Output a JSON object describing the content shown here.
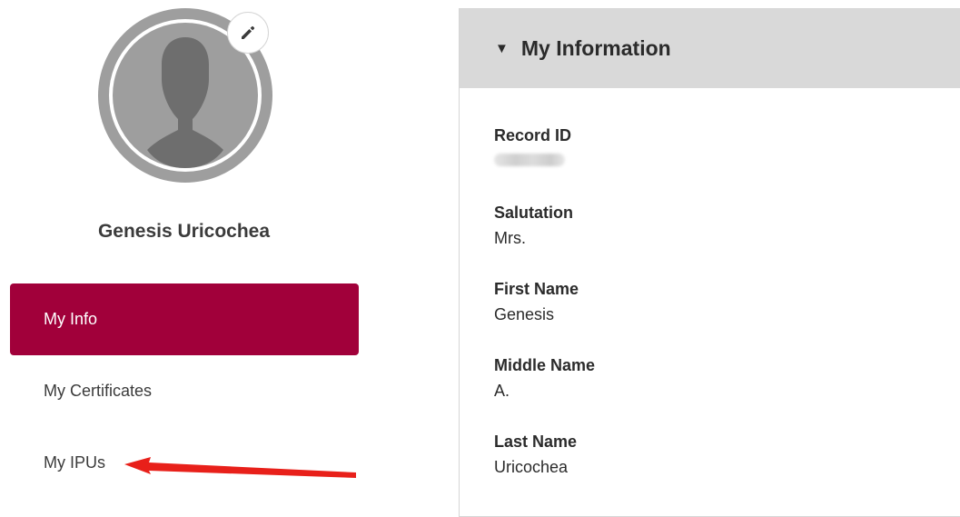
{
  "profile": {
    "name": "Genesis Uricochea"
  },
  "nav": {
    "items": [
      {
        "label": "My Info",
        "active": true
      },
      {
        "label": "My Certificates",
        "active": false
      },
      {
        "label": "My IPUs",
        "active": false
      }
    ]
  },
  "panel": {
    "title": "My Information",
    "caret": "▼",
    "fields": [
      {
        "label": "Record ID",
        "value": ""
      },
      {
        "label": "Salutation",
        "value": "Mrs."
      },
      {
        "label": "First Name",
        "value": "Genesis"
      },
      {
        "label": "Middle Name",
        "value": "A."
      },
      {
        "label": "Last Name",
        "value": "Uricochea"
      }
    ]
  },
  "colors": {
    "accent": "#a1003a",
    "annotation_arrow": "#e8201a"
  },
  "icons": {
    "edit": "pencil-icon",
    "avatar": "person-silhouette-icon"
  }
}
